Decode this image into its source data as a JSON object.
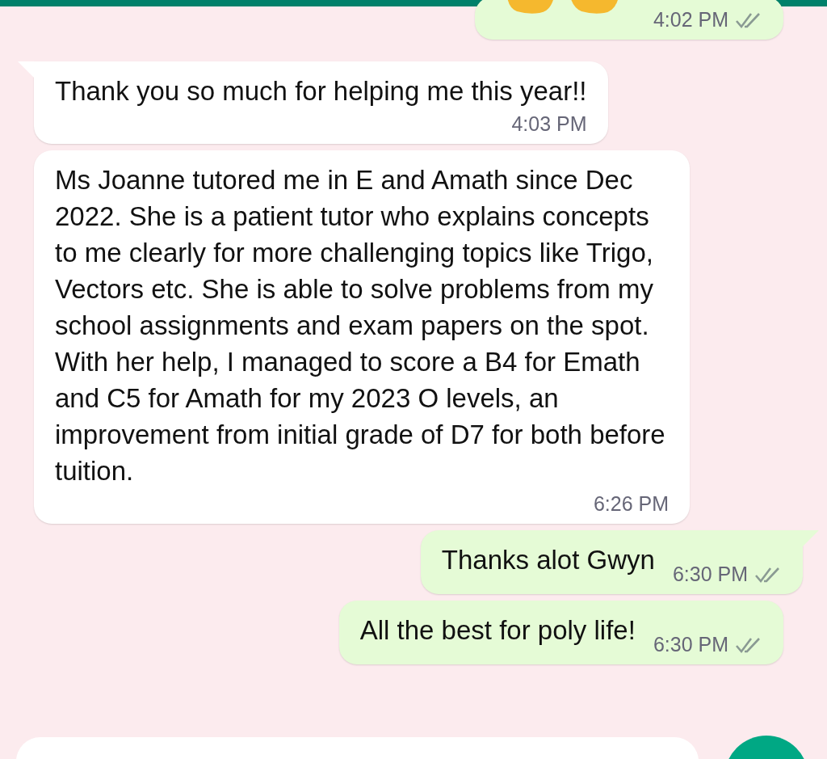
{
  "messages": [
    {
      "kind": "emoji",
      "outgoing": true,
      "time": "4:02 PM",
      "read": false,
      "tail": false
    },
    {
      "kind": "text",
      "outgoing": false,
      "text": "Thank you so much for helping me this year!!",
      "time": "4:03 PM",
      "tail": true
    },
    {
      "kind": "text",
      "outgoing": false,
      "text": "Ms Joanne tutored me in E and Amath since Dec 2022. She is a patient tutor who explains concepts to me clearly for more challenging topics like Trigo, Vectors etc. She is able to solve problems from my school assignments and exam papers on the spot. With her help, I managed to score a B4 for Emath and C5 for Amath for my 2023 O levels, an improvement from initial grade of D7 for both before tuition.",
      "time": "6:26 PM",
      "tail": false
    },
    {
      "kind": "text",
      "outgoing": true,
      "text": "Thanks alot Gwyn",
      "time": "6:30 PM",
      "read": false,
      "tail": true
    },
    {
      "kind": "text",
      "outgoing": true,
      "text": "All the best for poly life!",
      "time": "6:30 PM",
      "read": false,
      "tail": false
    }
  ]
}
